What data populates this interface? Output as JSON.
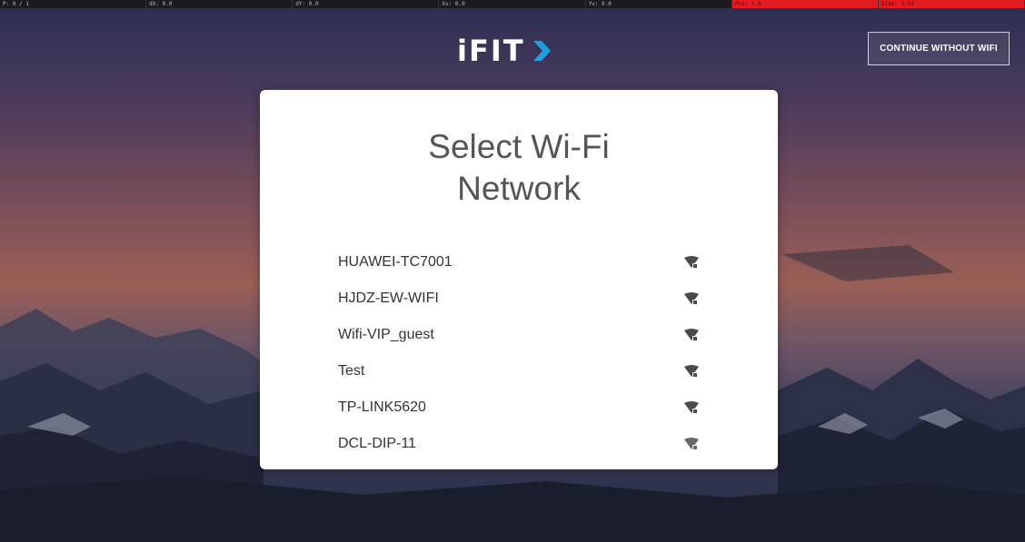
{
  "debug_bar": [
    {
      "label": "P: 0 / 1",
      "alert": false
    },
    {
      "label": "dX: 0.0",
      "alert": false
    },
    {
      "label": "dY: 0.0",
      "alert": false
    },
    {
      "label": "Xv: 0.0",
      "alert": false
    },
    {
      "label": "Yv: 0.0",
      "alert": false
    },
    {
      "label": "Prs: 1.0",
      "alert": true
    },
    {
      "label": "Size: 2.54",
      "alert": true
    }
  ],
  "header": {
    "logo_text": "iFIT",
    "logo_chevron_icon": "chevron-right-icon",
    "continue_label": "CONTINUE WITHOUT WIFI"
  },
  "card": {
    "title_line1": "Select Wi-Fi",
    "title_line2": "Network"
  },
  "networks": [
    {
      "name": "HUAWEI-TC7001",
      "icon": "wifi-lock-icon"
    },
    {
      "name": "HJDZ-EW-WIFI",
      "icon": "wifi-lock-icon"
    },
    {
      "name": "Wifi-VIP_guest",
      "icon": "wifi-lock-icon"
    },
    {
      "name": "Test",
      "icon": "wifi-lock-icon"
    },
    {
      "name": "TP-LINK5620",
      "icon": "wifi-lock-icon"
    },
    {
      "name": "DCL-DIP-11",
      "icon": "wifi-lock-icon"
    }
  ],
  "colors": {
    "accent": "#1e9fe0",
    "alert": "#e31b23",
    "card_background": "#ffffff"
  }
}
